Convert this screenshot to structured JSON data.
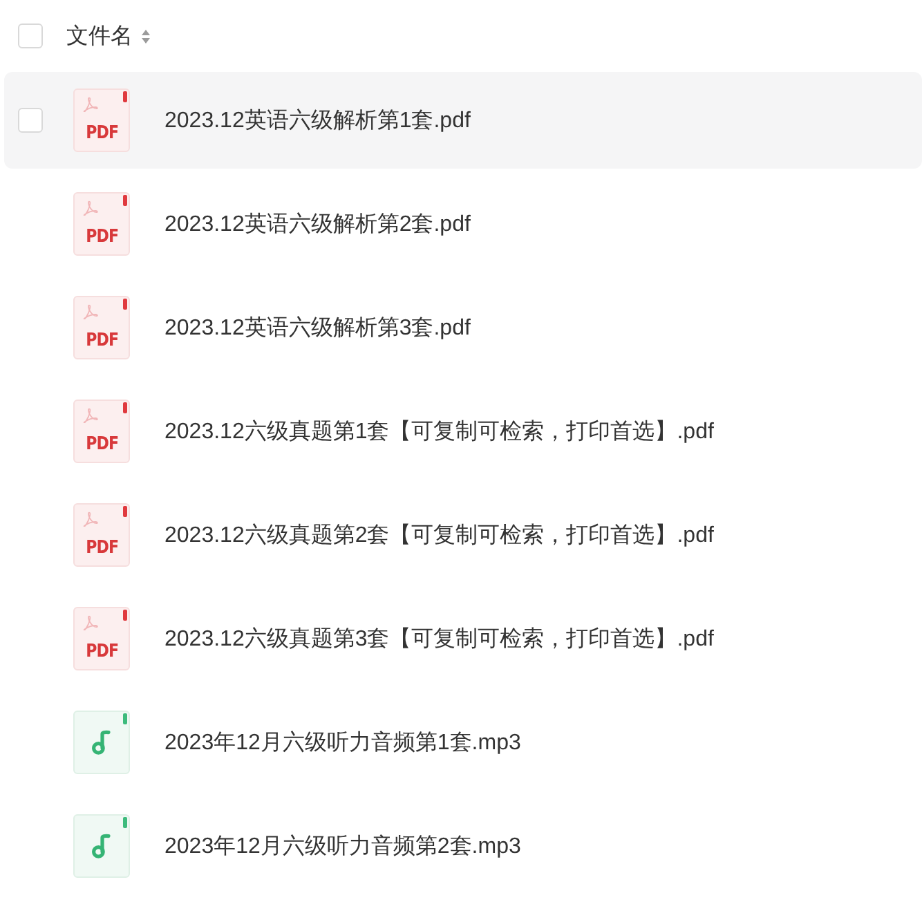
{
  "header": {
    "select_all": {
      "checked": false
    },
    "column_label": "文件名"
  },
  "files": [
    {
      "name": "2023.12英语六级解析第1套.pdf",
      "kind": "pdf",
      "badge": "PDF",
      "hovered": true,
      "checked": false
    },
    {
      "name": "2023.12英语六级解析第2套.pdf",
      "kind": "pdf",
      "badge": "PDF",
      "hovered": false,
      "checked": false
    },
    {
      "name": "2023.12英语六级解析第3套.pdf",
      "kind": "pdf",
      "badge": "PDF",
      "hovered": false,
      "checked": false
    },
    {
      "name": "2023.12六级真题第1套【可复制可检索，打印首选】.pdf",
      "kind": "pdf",
      "badge": "PDF",
      "hovered": false,
      "checked": false
    },
    {
      "name": "2023.12六级真题第2套【可复制可检索，打印首选】.pdf",
      "kind": "pdf",
      "badge": "PDF",
      "hovered": false,
      "checked": false
    },
    {
      "name": "2023.12六级真题第3套【可复制可检索，打印首选】.pdf",
      "kind": "pdf",
      "badge": "PDF",
      "hovered": false,
      "checked": false
    },
    {
      "name": "2023年12月六级听力音频第1套.mp3",
      "kind": "audio",
      "hovered": false,
      "checked": false
    },
    {
      "name": "2023年12月六级听力音频第2套.mp3",
      "kind": "audio",
      "hovered": false,
      "checked": false
    }
  ]
}
